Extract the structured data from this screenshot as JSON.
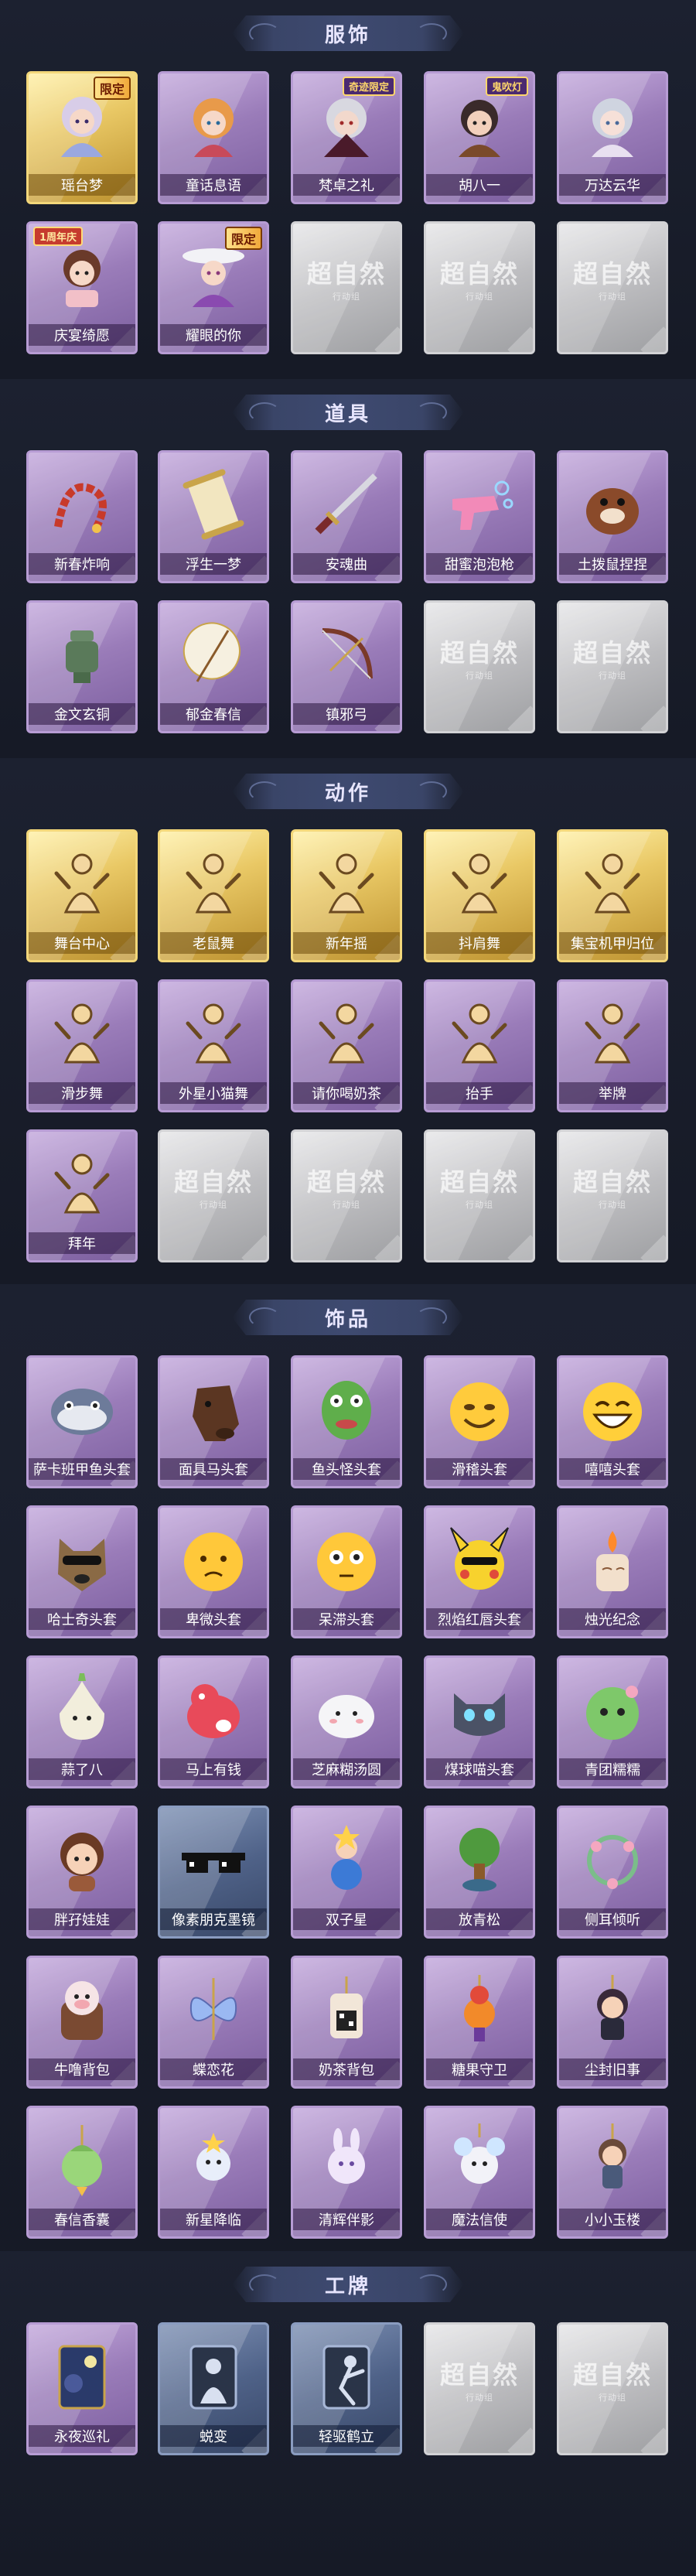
{
  "sections": [
    {
      "title": "服饰",
      "rows": [
        [
          {
            "label": "瑶台梦",
            "style": "gold",
            "icon": "costume-fairy-icon",
            "tag": "限定",
            "tag_type": "limited"
          },
          {
            "label": "童话息语",
            "style": "purple",
            "icon": "costume-girl-icon"
          },
          {
            "label": "梵卓之礼",
            "style": "purple",
            "icon": "costume-vampire-icon",
            "tag": "奇迹限定",
            "tag_type": "other"
          },
          {
            "label": "胡八一",
            "style": "purple",
            "icon": "costume-hunter-icon",
            "tag": "鬼吹灯",
            "tag_type": "other"
          },
          {
            "label": "万达云华",
            "style": "purple",
            "icon": "costume-elf-icon"
          }
        ],
        [
          {
            "label": "庆宴绮愿",
            "style": "purple",
            "icon": "costume-feast-icon",
            "tag": "1周年庆",
            "tag_type": "anniv"
          },
          {
            "label": "耀眼的你",
            "style": "purple",
            "icon": "costume-cowgirl-icon",
            "tag": "限定",
            "tag_type": "limited"
          },
          {
            "label": "",
            "style": "empty"
          },
          {
            "label": "",
            "style": "empty"
          },
          {
            "label": "",
            "style": "empty"
          }
        ]
      ]
    },
    {
      "title": "道具",
      "rows": [
        [
          {
            "label": "新春炸响",
            "style": "purple",
            "icon": "firecracker-icon"
          },
          {
            "label": "浮生一梦",
            "style": "purple",
            "icon": "scroll-icon"
          },
          {
            "label": "安魂曲",
            "style": "purple",
            "icon": "sword-icon"
          },
          {
            "label": "甜蜜泡泡枪",
            "style": "purple",
            "icon": "bubble-gun-icon"
          },
          {
            "label": "土拨鼠捏捏",
            "style": "purple",
            "icon": "groundhog-icon"
          }
        ],
        [
          {
            "label": "金文玄铜",
            "style": "purple",
            "icon": "bronze-vessel-icon"
          },
          {
            "label": "郁金春信",
            "style": "purple",
            "icon": "umbrella-icon"
          },
          {
            "label": "镇邪弓",
            "style": "purple",
            "icon": "bow-icon"
          },
          {
            "label": "",
            "style": "empty"
          },
          {
            "label": "",
            "style": "empty"
          }
        ]
      ]
    },
    {
      "title": "动作",
      "rows": [
        [
          {
            "label": "舞台中心",
            "style": "gold",
            "icon": "pose-icon"
          },
          {
            "label": "老鼠舞",
            "style": "gold",
            "icon": "pose-icon"
          },
          {
            "label": "新年摇",
            "style": "gold",
            "icon": "pose-icon"
          },
          {
            "label": "抖肩舞",
            "style": "gold",
            "icon": "pose-icon"
          },
          {
            "label": "集宝机甲归位",
            "style": "gold",
            "icon": "pose-icon"
          }
        ],
        [
          {
            "label": "滑步舞",
            "style": "purple",
            "icon": "pose-icon"
          },
          {
            "label": "外星小猫舞",
            "style": "purple",
            "icon": "pose-icon"
          },
          {
            "label": "请你喝奶茶",
            "style": "purple",
            "icon": "pose-icon"
          },
          {
            "label": "抬手",
            "style": "purple",
            "icon": "pose-icon"
          },
          {
            "label": "举牌",
            "style": "purple",
            "icon": "pose-icon"
          }
        ],
        [
          {
            "label": "拜年",
            "style": "purple",
            "icon": "pose-icon"
          },
          {
            "label": "",
            "style": "empty"
          },
          {
            "label": "",
            "style": "empty"
          },
          {
            "label": "",
            "style": "empty"
          },
          {
            "label": "",
            "style": "empty"
          }
        ]
      ]
    },
    {
      "title": "饰品",
      "rows": [
        [
          {
            "label": "萨卡班甲鱼头套",
            "style": "purple",
            "icon": "fish-head-icon"
          },
          {
            "label": "面具马头套",
            "style": "purple",
            "icon": "horse-head-icon"
          },
          {
            "label": "鱼头怪头套",
            "style": "purple",
            "icon": "fish-monster-icon"
          },
          {
            "label": "滑稽头套",
            "style": "purple",
            "icon": "funny-face-icon"
          },
          {
            "label": "嘻嘻头套",
            "style": "purple",
            "icon": "grin-face-icon"
          }
        ],
        [
          {
            "label": "哈士奇头套",
            "style": "purple",
            "icon": "husky-icon"
          },
          {
            "label": "卑微头套",
            "style": "purple",
            "icon": "humble-face-icon"
          },
          {
            "label": "呆滞头套",
            "style": "purple",
            "icon": "blank-face-icon"
          },
          {
            "label": "烈焰红唇头套",
            "style": "purple",
            "icon": "pikachu-icon"
          },
          {
            "label": "烛光纪念",
            "style": "purple",
            "icon": "candle-icon"
          }
        ],
        [
          {
            "label": "蒜了八",
            "style": "purple",
            "icon": "garlic-icon"
          },
          {
            "label": "马上有钱",
            "style": "purple",
            "icon": "red-horse-icon"
          },
          {
            "label": "芝麻糊汤圆",
            "style": "purple",
            "icon": "dumpling-icon"
          },
          {
            "label": "煤球喵头套",
            "style": "purple",
            "icon": "cat-head-icon"
          },
          {
            "label": "青团糯糯",
            "style": "purple",
            "icon": "green-ball-icon"
          }
        ],
        [
          {
            "label": "胖孖娃娃",
            "style": "purple",
            "icon": "doll-icon"
          },
          {
            "label": "像素朋克墨镜",
            "style": "blue",
            "icon": "pixel-glasses-icon"
          },
          {
            "label": "双子星",
            "style": "purple",
            "icon": "twin-star-icon"
          },
          {
            "label": "放青松",
            "style": "purple",
            "icon": "pine-icon"
          },
          {
            "label": "侧耳倾听",
            "style": "purple",
            "icon": "flower-ring-icon"
          }
        ],
        [
          {
            "label": "牛噜背包",
            "style": "purple",
            "icon": "cow-backpack-icon"
          },
          {
            "label": "蝶恋花",
            "style": "purple",
            "icon": "butterfly-icon"
          },
          {
            "label": "奶茶背包",
            "style": "purple",
            "icon": "milk-tea-icon"
          },
          {
            "label": "糖果守卫",
            "style": "purple",
            "icon": "candy-guard-icon"
          },
          {
            "label": "尘封旧事",
            "style": "purple",
            "icon": "chibi-icon"
          }
        ],
        [
          {
            "label": "春信香囊",
            "style": "purple",
            "icon": "sachet-icon"
          },
          {
            "label": "新星降临",
            "style": "purple",
            "icon": "star-charm-icon"
          },
          {
            "label": "清辉伴影",
            "style": "purple",
            "icon": "bunny-charm-icon"
          },
          {
            "label": "魔法信使",
            "style": "purple",
            "icon": "mouse-charm-icon"
          },
          {
            "label": "小小玉楼",
            "style": "purple",
            "icon": "doll-charm-icon"
          }
        ]
      ]
    },
    {
      "title": "工牌",
      "rows": [
        [
          {
            "label": "永夜巡礼",
            "style": "purple",
            "icon": "badge-night-icon"
          },
          {
            "label": "蜕变",
            "style": "blue",
            "icon": "badge-silhouette-icon"
          },
          {
            "label": "轻驱鹤立",
            "style": "blue",
            "icon": "badge-dancer-icon"
          },
          {
            "label": "",
            "style": "empty"
          },
          {
            "label": "",
            "style": "empty"
          }
        ]
      ]
    }
  ],
  "empty_watermark": "超自然",
  "empty_watermark_sub": "行动组",
  "colors": {
    "background": "#161a26",
    "rare": "#9a7cb9",
    "legendary": "#e9c865"
  }
}
